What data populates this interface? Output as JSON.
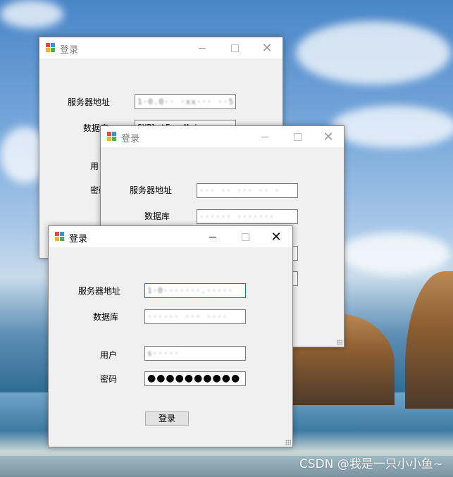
{
  "windows": [
    {
      "title": "登录",
      "labels": {
        "server": "服务器地址",
        "database": "数据库",
        "user": "用",
        "password": "密码"
      },
      "values": {
        "server": "1·0.0·· ·xx··· ··5",
        "database": "SXPlatFormMain"
      }
    },
    {
      "title": "登录",
      "labels": {
        "server": "服务器地址",
        "database": "数据库"
      },
      "values": {
        "server": "··· ·· ··· ·· ·",
        "database": "······ ·······"
      }
    },
    {
      "title": "登录",
      "labels": {
        "server": "服务器地址",
        "database": "数据库",
        "user": "用户",
        "password": "密码"
      },
      "values": {
        "server": "1·0·······.·····",
        "database": "······ ··· ····",
        "user": "s·····",
        "password": "●●●●●●●●●●"
      },
      "login_button": "登录"
    }
  ],
  "watermark": "CSDN @我是一只小小鱼~"
}
